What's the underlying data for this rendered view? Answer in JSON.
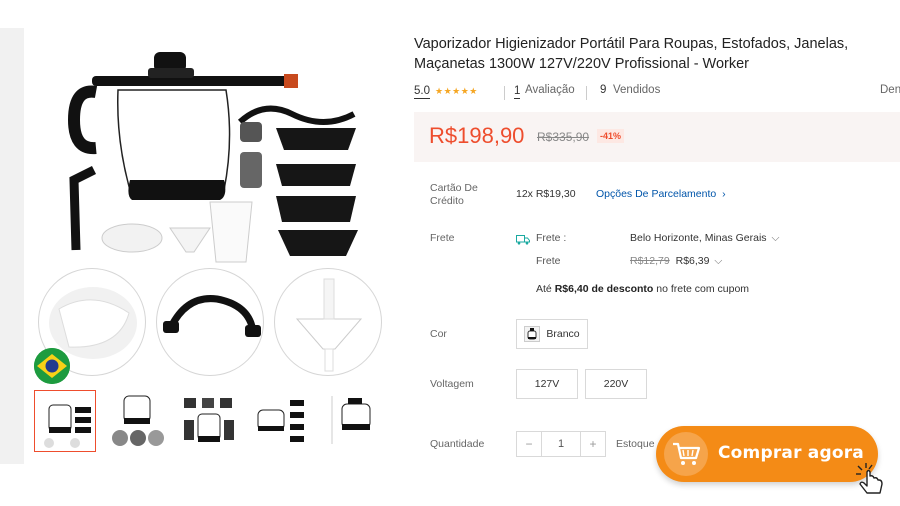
{
  "product": {
    "title": "Vaporizador Higienizador Portátil Para Roupas, Estofados, Janelas, Maçanetas 1300W 127V/220V Profissional - Worker",
    "rating": "5.0",
    "stars": "★★★★★",
    "reviews_count": "1",
    "reviews_label": "Avaliação",
    "sold_count": "9",
    "sold_label": "Vendidos",
    "report_label": "Denu"
  },
  "price": {
    "current": "R$198,90",
    "original": "R$335,90",
    "discount": "-41%"
  },
  "installments": {
    "label": "Cartão De Crédito",
    "value": "12x R$19,30",
    "link": "Opções De Parcelamento",
    "link_icon": "chevron-right-icon"
  },
  "shipping": {
    "label": "Frete",
    "to_label": "Frete :",
    "destination": "Belo Horizonte, Minas Gerais",
    "cost_label": "Frete",
    "original_cost": "R$12,79",
    "cost": "R$6,39",
    "discount_prefix": "Até",
    "discount_amount": "R$6,40 de desconto",
    "discount_suffix": "no frete com cupom"
  },
  "color": {
    "label": "Cor",
    "options": [
      "Branco"
    ]
  },
  "voltage": {
    "label": "Voltagem",
    "options": [
      "127V",
      "220V"
    ]
  },
  "quantity": {
    "label": "Quantidade",
    "minus": "−",
    "value": "1",
    "plus": "+",
    "stock_label": "Estoque"
  },
  "cta": {
    "label": "Comprar agora",
    "icon": "shopping-cart-icon"
  },
  "colors": {
    "accent": "#ee4d2d",
    "cta": "#f48b16",
    "link": "#0055aa"
  }
}
